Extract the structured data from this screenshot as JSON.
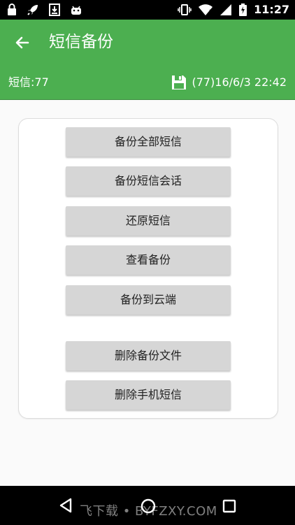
{
  "status_bar": {
    "time": "11:27",
    "left_icons": [
      "lock-icon",
      "rocket-icon",
      "download-icon",
      "android-icon"
    ],
    "right_icons": [
      "vibrate-icon",
      "wifi-icon",
      "signal-icon",
      "battery-charging-icon"
    ]
  },
  "toolbar": {
    "title": "短信备份",
    "back_icon": "arrow-left-icon"
  },
  "info_bar": {
    "sms_count": "短信:77",
    "backup_info": "(77)16/6/3 22:42",
    "save_icon": "floppy-disk-icon"
  },
  "actions": {
    "backup_all": "备份全部短信",
    "backup_conversations": "备份短信会话",
    "restore": "还原短信",
    "view_backups": "查看备份",
    "backup_cloud": "备份到云端",
    "delete_backup_files": "删除备份文件",
    "delete_phone_sms": "删除手机短信"
  },
  "nav_bar": {
    "watermark": "飞下载 • BYFZXY.COM",
    "icons": [
      "nav-back-icon",
      "nav-home-icon",
      "nav-recents-icon"
    ]
  },
  "colors": {
    "primary": "#4caf50",
    "button_bg": "#d6d6d6",
    "background": "#fafafa"
  }
}
